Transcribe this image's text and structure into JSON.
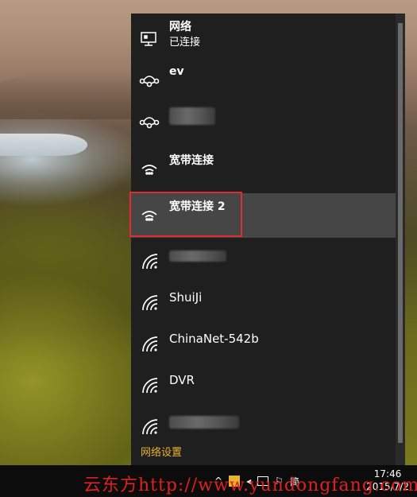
{
  "networks": {
    "wired": {
      "name": "网络",
      "status": "已连接",
      "icon": "ethernet-monitor-icon"
    },
    "items": [
      {
        "name": "ev",
        "icon": "network-connection-icon"
      },
      {
        "name": "",
        "icon": "network-connection-icon",
        "redacted": true
      },
      {
        "name": "宽带连接",
        "icon": "dialup-connection-icon"
      },
      {
        "name": "宽带连接 2",
        "icon": "dialup-connection-icon",
        "selected": true
      },
      {
        "name": "",
        "icon": "wifi-icon",
        "redacted": true
      },
      {
        "name": "ShuiJi",
        "icon": "wifi-icon"
      },
      {
        "name": "ChinaNet-542b",
        "icon": "wifi-icon"
      },
      {
        "name": "DVR",
        "icon": "wifi-icon"
      },
      {
        "name": "",
        "icon": "wifi-icon",
        "redacted": true
      }
    ],
    "settings_link": "网络设置"
  },
  "taskbar": {
    "time": "17:46",
    "date": "2015/7/2",
    "tray_text": "简"
  },
  "watermark": "云东方http://www.yundongfang.com",
  "colors": {
    "flyout_bg": "#1f1f1f",
    "selected_bg": "#464646",
    "highlight_border": "#e02d2d",
    "link": "#e8b22e",
    "watermark": "#e02020"
  }
}
